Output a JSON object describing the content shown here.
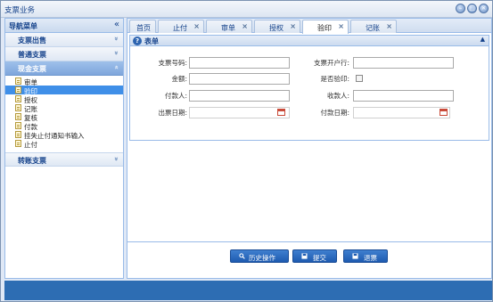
{
  "window": {
    "title": "支票业务",
    "buttons": [
      "–",
      "□",
      "×"
    ]
  },
  "nav": {
    "header": "导航菜单",
    "collapse_glyph": "«",
    "sections": [
      {
        "label": "支票出售",
        "chevron": "»"
      },
      {
        "label": "普通支票",
        "chevron": "»"
      },
      {
        "label": "现金支票",
        "chevron": "»",
        "active": true
      },
      {
        "label": "转账支票",
        "chevron": "»"
      }
    ],
    "items": [
      "审单",
      "验印",
      "授权",
      "记账",
      "复核",
      "付款",
      "挂失止付通知书输入",
      "止付"
    ],
    "selected_item": "验印"
  },
  "tabs": [
    {
      "label": "首页",
      "closable": false
    },
    {
      "label": "止付",
      "closable": true
    },
    {
      "label": "审单",
      "closable": true
    },
    {
      "label": "授权",
      "closable": true
    },
    {
      "label": "验印",
      "closable": true,
      "active": true
    },
    {
      "label": "记账",
      "closable": true
    }
  ],
  "tab_close_glyph": "×",
  "panel": {
    "title": "表单",
    "help_glyph": "?",
    "collapse_glyph": "▲"
  },
  "form": {
    "cheque_no_label": "支票号码:",
    "cheque_no_value": "",
    "bank_label": "支票开户行:",
    "bank_value": "",
    "amount_label": "金额:",
    "amount_value": "",
    "verified_label": "是否验印:",
    "payer_label": "付款人:",
    "payer_value": "",
    "payee_label": "收款人:",
    "payee_value": "",
    "issue_date_label": "出票日期:",
    "issue_date_value": "",
    "pay_date_label": "付款日期:",
    "pay_date_value": ""
  },
  "actions": {
    "history_label": "历史操作",
    "submit_label": "提交",
    "return_label": "退票"
  },
  "colors": {
    "accent": "#1e5bb0",
    "footer": "#2d6db3",
    "selection": "#3f8fe8"
  }
}
